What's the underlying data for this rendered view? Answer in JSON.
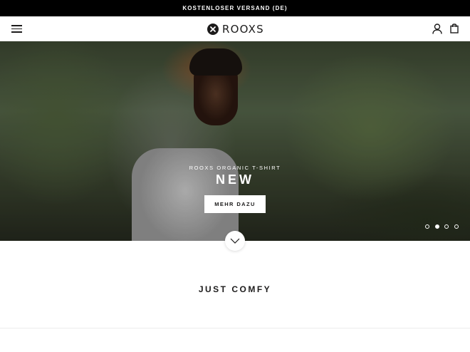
{
  "announcement": {
    "text": "KOSTENLOSER VERSAND (DE)"
  },
  "header": {
    "logo_text": "ROOXS",
    "icons": {
      "menu": "hamburger-menu-icon",
      "account": "user-icon",
      "cart": "shopping-bag-icon"
    }
  },
  "hero": {
    "subtitle": "ROOXS ORGANIC T-SHIRT",
    "title": "NEW",
    "button_label": "MEHR DAZU",
    "slides_count": 4,
    "active_slide": 2
  },
  "scroll_icon": "chevron-down-icon",
  "section": {
    "title": "JUST COMFY"
  },
  "colors": {
    "announcement_bg": "#000000",
    "text": "#1c1b1b",
    "button_bg": "#ffffff"
  }
}
